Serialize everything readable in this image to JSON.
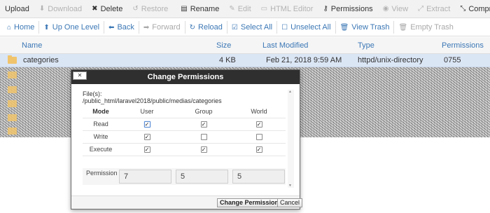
{
  "toolbar1": {
    "items": [
      {
        "label": "Upload",
        "icon": "",
        "disabled": false
      },
      {
        "label": "Download",
        "icon": "download-icon",
        "disabled": true
      },
      {
        "label": "Delete",
        "icon": "x-icon",
        "disabled": false
      },
      {
        "label": "Restore",
        "icon": "restore-icon",
        "disabled": true
      },
      {
        "label": "Rename",
        "icon": "rename-icon",
        "disabled": false
      },
      {
        "label": "Edit",
        "icon": "pencil-icon",
        "disabled": true
      },
      {
        "label": "HTML Editor",
        "icon": "code-icon",
        "disabled": true
      },
      {
        "label": "Permissions",
        "icon": "key-icon",
        "disabled": false
      },
      {
        "label": "View",
        "icon": "eye-icon",
        "disabled": true
      },
      {
        "label": "Extract",
        "icon": "expand-icon",
        "disabled": true
      },
      {
        "label": "Compress",
        "icon": "compress-icon",
        "disabled": false
      }
    ]
  },
  "toolbar2": {
    "items": [
      {
        "label": "Home",
        "icon": "home-icon",
        "disabled": false
      },
      {
        "label": "Up One Level",
        "icon": "up-arrow-icon",
        "disabled": false
      },
      {
        "label": "Back",
        "icon": "back-arrow-icon",
        "disabled": false
      },
      {
        "label": "Forward",
        "icon": "forward-arrow-icon",
        "disabled": true
      },
      {
        "label": "Reload",
        "icon": "reload-icon",
        "disabled": false
      },
      {
        "label": "Select All",
        "icon": "checkbox-checked-icon",
        "disabled": false
      },
      {
        "label": "Unselect All",
        "icon": "checkbox-empty-icon",
        "disabled": false
      },
      {
        "label": "View Trash",
        "icon": "trash-icon",
        "disabled": false
      },
      {
        "label": "Empty Trash",
        "icon": "trash-empty-icon",
        "disabled": true
      }
    ]
  },
  "list": {
    "columns": {
      "name": "Name",
      "size": "Size",
      "modified": "Last Modified",
      "type": "Type",
      "perms": "Permissions"
    },
    "selected_row": {
      "name": "categories",
      "size": "4 KB",
      "modified": "Feb 21, 2018 9:59 AM",
      "type": "httpd/unix-directory",
      "perms": "0755"
    }
  },
  "modal": {
    "title": "Change Permissions",
    "close_label": "✕",
    "files_label": "File(s):",
    "files_path": "/public_html/laravel2018/public/medias/categories",
    "headers": {
      "mode": "Mode",
      "user": "User",
      "group": "Group",
      "world": "World"
    },
    "rows": [
      {
        "label": "Read",
        "user": true,
        "group": true,
        "world": true
      },
      {
        "label": "Write",
        "user": true,
        "group": false,
        "world": false
      },
      {
        "label": "Execute",
        "user": true,
        "group": true,
        "world": true
      }
    ],
    "permission_label": "Permission",
    "permission_values": {
      "user": "7",
      "group": "5",
      "world": "5"
    },
    "submit_label": "Change Permissions",
    "cancel_label": "Cancel"
  },
  "colors": {
    "accent": "#3b77b5",
    "selected_row": "#dbe6f5",
    "modal_title_bg": "#2f2f2f"
  }
}
